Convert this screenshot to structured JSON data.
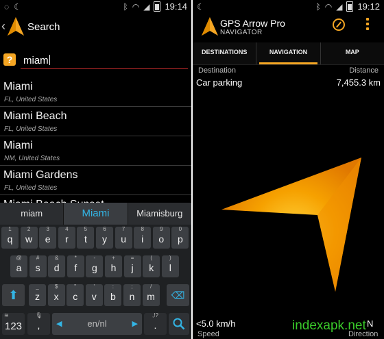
{
  "left": {
    "status": {
      "time": "19:14"
    },
    "title": "Search",
    "query": "miam",
    "results": [
      {
        "name": "Miami",
        "region": "FL,  United States"
      },
      {
        "name": "Miami Beach",
        "region": "FL,  United States"
      },
      {
        "name": "Miami",
        "region": "NM,  United States"
      },
      {
        "name": "Miami Gardens",
        "region": "FL,  United States"
      },
      {
        "name": "Miami Beach Sunset",
        "region": ""
      }
    ],
    "suggestions": [
      "miam",
      "Miami",
      "Miamisburg"
    ],
    "keyboard": {
      "row1": [
        [
          "q",
          "1"
        ],
        [
          "w",
          "2"
        ],
        [
          "e",
          "3"
        ],
        [
          "r",
          "4"
        ],
        [
          "t",
          "5"
        ],
        [
          "y",
          "6"
        ],
        [
          "u",
          "7"
        ],
        [
          "i",
          "8"
        ],
        [
          "o",
          "9"
        ],
        [
          "p",
          "0"
        ]
      ],
      "row2": [
        [
          "a",
          "@"
        ],
        [
          "s",
          "#"
        ],
        [
          "d",
          "&"
        ],
        [
          "f",
          "*"
        ],
        [
          "g",
          "-"
        ],
        [
          "h",
          "+"
        ],
        [
          "j",
          "="
        ],
        [
          "k",
          "("
        ],
        [
          "l",
          ")"
        ]
      ],
      "row3": [
        [
          "z",
          "_"
        ],
        [
          "x",
          "$"
        ],
        [
          "c",
          "\""
        ],
        [
          "v",
          "'"
        ],
        [
          "b",
          ":"
        ],
        [
          "n",
          ";"
        ],
        [
          "m",
          "/"
        ]
      ],
      "lang": "en/nl",
      "num_key": "123",
      "punct_key": ",!?",
      "punct_hint": ".",
      "colors": {
        "accent": "#33b5e5"
      }
    }
  },
  "right": {
    "status": {
      "time": "19:12"
    },
    "app_title": "GPS Arrow Pro",
    "app_subtitle": "NAVIGATOR",
    "tabs": [
      {
        "label": "DESTINATIONS",
        "active": false
      },
      {
        "label": "NAVIGATION",
        "active": true
      },
      {
        "label": "MAP",
        "active": false
      }
    ],
    "destination_label": "Destination",
    "distance_label": "Distance",
    "destination": "Car parking",
    "distance": "7,455.3 km",
    "speed": "<5.0 km/h",
    "speed_label": "Speed",
    "direction": "N",
    "direction_label": "Direction",
    "colors": {
      "accent": "#f5a623"
    }
  },
  "watermark": "indexapk.net"
}
